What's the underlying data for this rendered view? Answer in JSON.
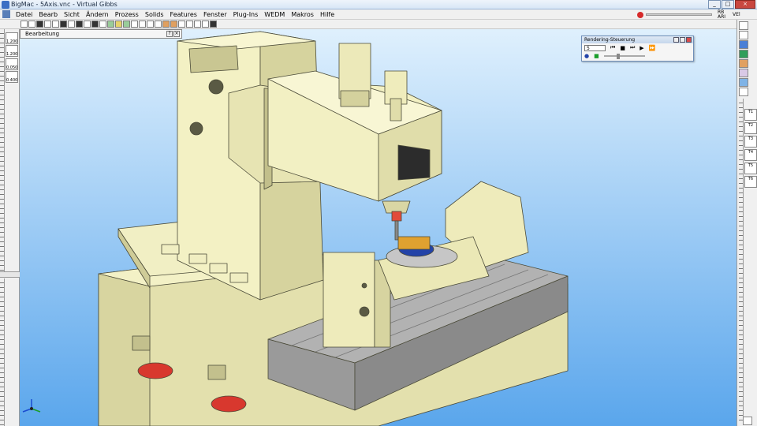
{
  "window": {
    "title": "BigMac - 5Axis.vnc - Virtual Gibbs"
  },
  "menu": [
    "Datei",
    "Bearb",
    "Sicht",
    "Ändern",
    "Prozess",
    "Solids",
    "Features",
    "Fenster",
    "Plug-Ins",
    "WEDM",
    "Makros",
    "Hilfe"
  ],
  "top_right_labels": [
    "RB",
    "ARI",
    "VEl"
  ],
  "bearbeitung_panel": {
    "label": "Bearbeitung"
  },
  "rendering_panel": {
    "title": "Rendering-Steuerung",
    "step_value": "5"
  },
  "left_tools": [
    "1.200",
    "1.200",
    "0.050",
    "0.400"
  ],
  "right_tools": [
    "T1",
    "T2",
    "T3",
    "T4",
    "T5",
    "T6"
  ],
  "colors": {
    "background_top": "#e0f1fd",
    "background_bottom": "#56a3ec",
    "machine": "#f3f1c2",
    "machine_shade": "#d9d6a2",
    "table_gray": "#a7a7a7",
    "red_foot": "#d8382e"
  }
}
